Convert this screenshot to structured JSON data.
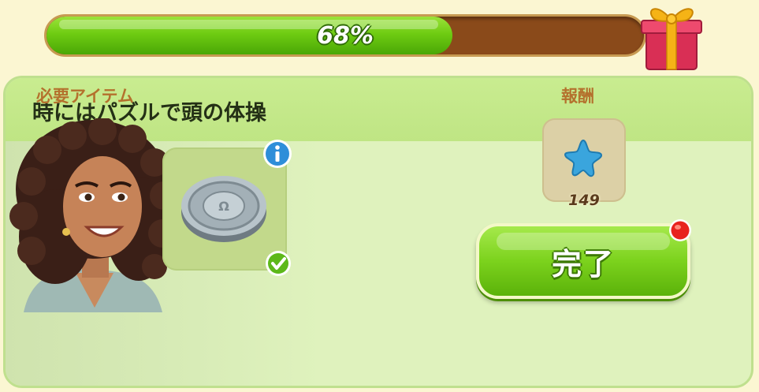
{
  "progress": {
    "percent": 68,
    "label": "68%"
  },
  "panel": {
    "title": "時にはパズルで頭の体操",
    "required_label": "必要アイテム",
    "reward_label": "報酬"
  },
  "required_item": {
    "icon": "silver-coin-icon",
    "info_icon": "info-icon",
    "status_icon": "checkmark-icon"
  },
  "reward": {
    "icon": "blue-star-icon",
    "count": "149"
  },
  "complete_button": {
    "label": "完了",
    "notification": true
  },
  "colors": {
    "progress_fill": "#6fcc12",
    "progress_track": "#8a4a1a",
    "button_green": "#7cd21d",
    "panel_bg": "#dff2bd",
    "label_orange": "#b4712d",
    "notify_red": "#e8231e"
  }
}
